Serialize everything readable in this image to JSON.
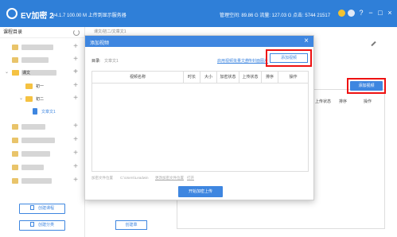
{
  "app": {
    "title": "EV加密 2",
    "version": "v4.1.7  100.00 M 上传到显示服务器",
    "stats": "管理空间: 89.86 G  流量: 127.03 G  点击: 5744  21517",
    "window_controls": [
      "?",
      "−",
      "□",
      "×"
    ]
  },
  "sidebar": {
    "heading": "课程目录",
    "tree": [
      {
        "label": "",
        "kind": "blurred"
      },
      {
        "label": "",
        "kind": "blurred"
      },
      {
        "label": "",
        "kind": "blurred"
      },
      {
        "label": "课文",
        "kind": "folder-open"
      },
      {
        "label": "初一",
        "kind": "folder"
      },
      {
        "label": "初二",
        "kind": "folder-open"
      },
      {
        "label": "文章文1",
        "kind": "doc-selected"
      },
      {
        "label": "",
        "kind": "blurred"
      },
      {
        "label": "",
        "kind": "blurred"
      },
      {
        "label": "",
        "kind": "blurred"
      },
      {
        "label": "",
        "kind": "blurred"
      },
      {
        "label": "",
        "kind": "blurred"
      }
    ],
    "create_course_label": "创建课程",
    "create_category_label": "创建分类"
  },
  "main": {
    "breadcrumb": "课文/初二/文章文1",
    "add_video_label": "添加视频",
    "table_headers": [
      "上传状态",
      "排序",
      "操作"
    ],
    "create_chapter_label": "创建章"
  },
  "dialog": {
    "title": "添加视频",
    "close_label": "×",
    "directory_label": "目录:",
    "directory_value": "文章文1",
    "link_enable_batch": "启用视频批量文件",
    "link_upload_cover": "上传封面图片",
    "add_video_label": "添加视频",
    "columns": [
      "视频名称",
      "时长",
      "大小",
      "加密状态",
      "上传状态",
      "排序",
      "操作"
    ],
    "save_path_label": "加密文件位置",
    "save_path_value": "C:\\Users\\Leadwin",
    "change_path_label": "更改加密文件位置",
    "open_label": "打开",
    "upload_button_label": "开始加密上传"
  },
  "colors": {
    "brand_blue": "#2f7fd8",
    "accent_blue": "#3e86e0",
    "highlight_red": "#ee1111"
  }
}
